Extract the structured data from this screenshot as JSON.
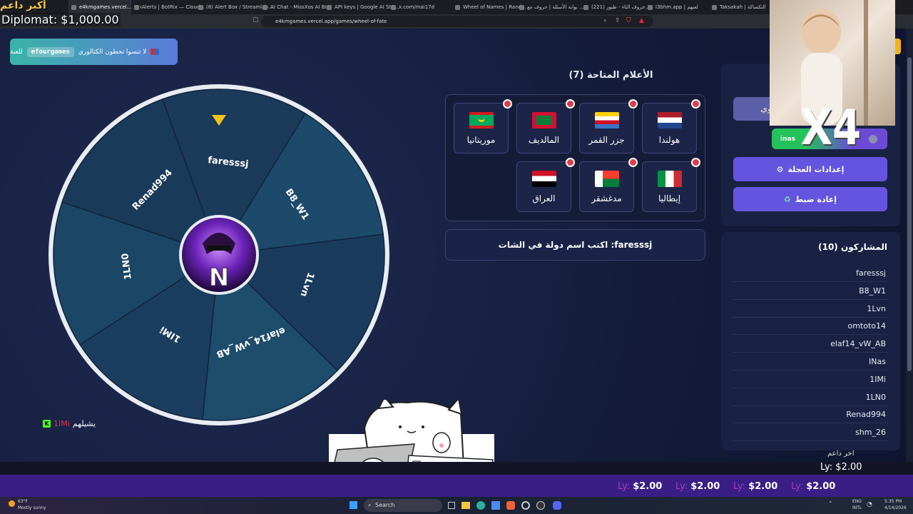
{
  "browser": {
    "tabs": [
      {
        "label": "e4kmgames.vercel...",
        "active": true
      },
      {
        "label": "Alerts | BotRix — Cloud..."
      },
      {
        "label": "(8) Alert Box / Streamlab..."
      },
      {
        "label": "AI Chat - MissXos AI Bot"
      },
      {
        "label": "API keys | Google AI Stu..."
      },
      {
        "label": "x.com/mai17d"
      },
      {
        "label": "Wheel of Names | Rand..."
      },
      {
        "label": "بوابة الأسئلة | حروف مع ..."
      },
      {
        "label": "(221) حروف الثاء - طيور..."
      },
      {
        "label": "l3bhm.app | لعبهم"
      },
      {
        "label": "Taksakah | التكساكة"
      }
    ],
    "url": "e4kmgames.vercel.app/games/wheel-of-fate"
  },
  "stream_overlay": {
    "top_donation_label": "أكبر داعم",
    "top_donor": "Diplomat: $1,000.00",
    "last_donor_label": "اخر داعم",
    "last_donor": "Ly: $2.00",
    "ticker": [
      {
        "prefix": "Ly:",
        "amount": "$2.00"
      },
      {
        "prefix": "Ly:",
        "amount": "$2.00"
      },
      {
        "prefix": "Ly:",
        "amount": "$2.00"
      },
      {
        "prefix": "Ly:",
        "amount": "$2.00"
      }
    ],
    "multiplier": "X4"
  },
  "reminder": {
    "text": "لا تنسوا تحطون الكتالوري",
    "code": "efourgames",
    "suffix": "للعبة"
  },
  "wheel": {
    "segments": [
      "faresssj",
      "B8_W1",
      "1Lvn",
      "elaf14_vW_AB",
      "1IMi",
      "1LN0",
      "Renad994"
    ],
    "center_logo": "N",
    "colors": [
      "#1c3a5a",
      "#1d4a6a",
      "#1a3b5c",
      "#1e4d6c",
      "#1b3d5e",
      "#1c4666",
      "#1a3a5a"
    ]
  },
  "flags": {
    "title": "الأعلام المتاحة (7)",
    "items": [
      {
        "name": "هولندا",
        "flag": "netherlands"
      },
      {
        "name": "جزر القمر",
        "flag": "comoros"
      },
      {
        "name": "المالديف",
        "flag": "maldives"
      },
      {
        "name": "موريتانيا",
        "flag": "mauritania"
      },
      {
        "name": "إيطاليا",
        "flag": "italy"
      },
      {
        "name": "مدغشقر",
        "flag": "madagascar"
      },
      {
        "name": "العراق",
        "flag": "iraq"
      }
    ]
  },
  "prompt": {
    "user": "faresssj:",
    "text": "اكتب اسم دولة في الشات"
  },
  "controls": {
    "hidden_button_partial": "وي",
    "toggle_label": "inas",
    "wheel_settings": "إعدادات العجلة",
    "wheel_settings_icon": "gear-icon",
    "reset": "إعادة ضبط",
    "reset_icon": "recycle-icon"
  },
  "participants": {
    "title": "المشاركون (10)",
    "names": [
      "faresssj",
      "B8_W1",
      "1Lvn",
      "omtoto14",
      "elaf14_vW_AB",
      "INas",
      "1IMi",
      "1LN0",
      "Renad994",
      "shm_26"
    ]
  },
  "winner_overlay": {
    "label": "يشيلهم",
    "name": "1IMi",
    "platform": "K"
  },
  "taskbar": {
    "weather_temp": "63°F",
    "weather_desc": "Mostly sunny",
    "search": "Search",
    "lang": "ENG",
    "region": "INTL",
    "time": "5:35 PM",
    "date": "4/14/2026"
  }
}
